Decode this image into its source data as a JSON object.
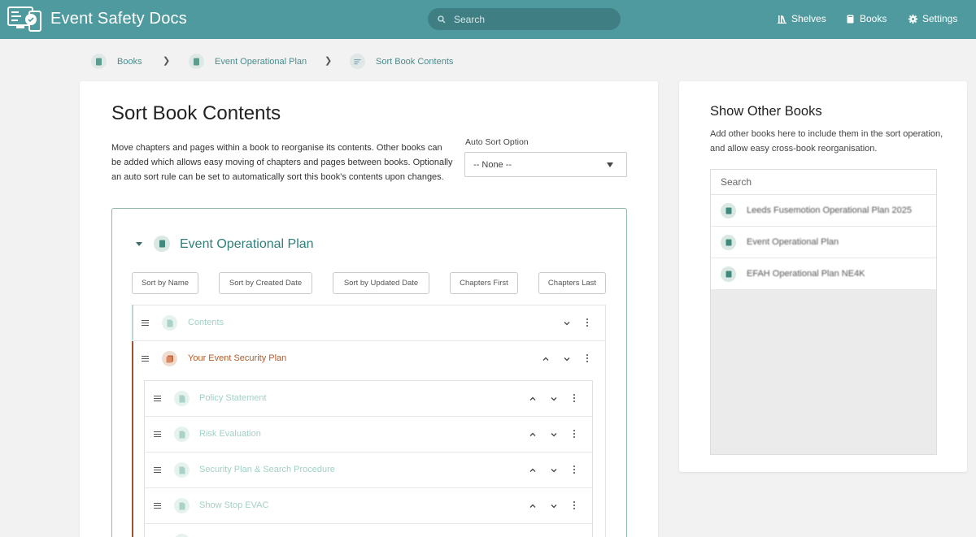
{
  "header": {
    "app_title": "Event Safety Docs",
    "search_placeholder": "Search",
    "nav": [
      {
        "label": "Shelves",
        "icon": "shelves-icon"
      },
      {
        "label": "Books",
        "icon": "books-icon"
      },
      {
        "label": "Settings",
        "icon": "settings-gear-icon"
      }
    ]
  },
  "breadcrumb": [
    {
      "label": "Books",
      "icon": "book-icon"
    },
    {
      "label": "Event Operational Plan",
      "icon": "book-icon"
    },
    {
      "label": "Sort Book Contents",
      "icon": "sort-icon"
    }
  ],
  "main": {
    "title": "Sort Book Contents",
    "description": "Move chapters and pages within a book to reorganise its contents. Other books can be added which allows easy moving of chapters and pages between books. Optionally an auto sort rule can be set to automatically sort this book's contents upon changes.",
    "auto_sort": {
      "label": "Auto Sort Option",
      "value": "-- None --"
    },
    "book": {
      "name": "Event Operational Plan",
      "sort_buttons": [
        "Sort by Name",
        "Sort by Created Date",
        "Sort by Updated Date",
        "Chapters First",
        "Chapters Last"
      ],
      "items": [
        {
          "type": "page",
          "label": "Contents"
        },
        {
          "type": "chapter",
          "label": "Your Event Security Plan"
        }
      ],
      "chapter_pages": [
        {
          "label": "Policy Statement"
        },
        {
          "label": "Risk Evaluation"
        },
        {
          "label": "Security Plan & Search Procedure"
        },
        {
          "label": "Show Stop EVAC"
        }
      ]
    }
  },
  "side": {
    "title": "Show Other Books",
    "description": "Add other books here to include them in the sort operation, and allow easy cross-book reorganisation.",
    "search_placeholder": "Search",
    "books": [
      {
        "label": "Leeds Fusemotion Operational Plan 2025"
      },
      {
        "label": "Event Operational Plan"
      },
      {
        "label": "EFAH Operational Plan NE4K"
      }
    ]
  },
  "colors": {
    "header_bg": "#4f9a9e",
    "accent": "#2f7f7a",
    "chapter": "#b35b2b",
    "page": "#9fd1c6"
  }
}
